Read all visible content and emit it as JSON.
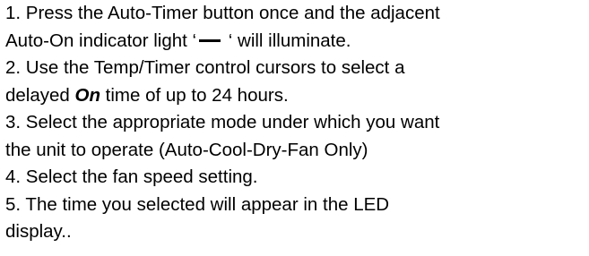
{
  "steps": {
    "line1": "1. Press the Auto-Timer button once and the adjacent",
    "line2_pre": "Auto-On indicator light ‘",
    "line2_post": " ‘ will illuminate.",
    "line3": "2. Use the Temp/Timer control cursors to select a",
    "line4_pre": "delayed ",
    "line4_bold": "On",
    "line4_post": " time of up to 24 hours.",
    "line5": "3. Select the  appropriate mode under which you want",
    "line6": "the unit to operate (Auto-Cool-Dry-Fan Only)",
    "line7": "4. Select the fan speed setting.",
    "line8": "5.  The time you selected will appear in the LED",
    "line9": "display.."
  },
  "icons": {
    "indicator": "dash-indicator-icon"
  }
}
